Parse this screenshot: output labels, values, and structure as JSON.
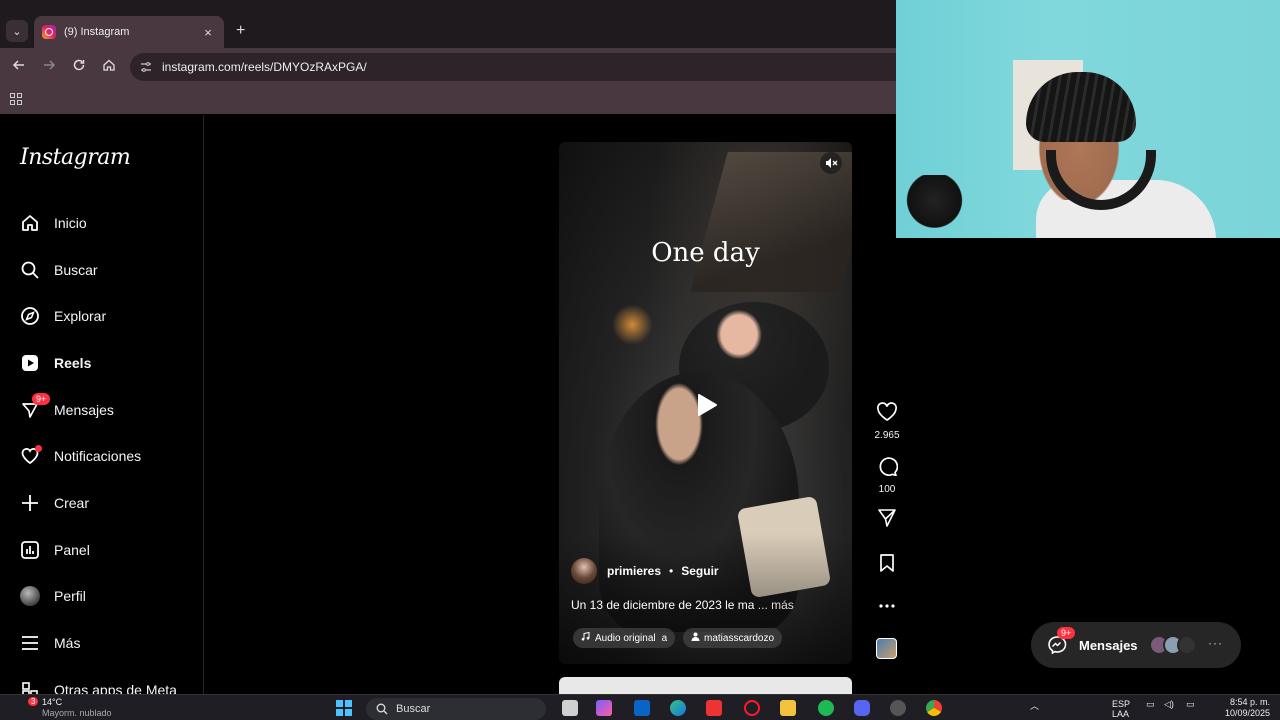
{
  "browser": {
    "tab_title": "(9) Instagram",
    "tab_close": "×",
    "new_tab": "+",
    "tab_list": "⌄",
    "url": "instagram.com/reels/DMYOzRAxPGA/"
  },
  "sidebar": {
    "logo": "Instagram",
    "items": [
      {
        "label": "Inicio",
        "icon": "home-icon"
      },
      {
        "label": "Buscar",
        "icon": "search-icon"
      },
      {
        "label": "Explorar",
        "icon": "compass-icon"
      },
      {
        "label": "Reels",
        "icon": "reels-icon"
      },
      {
        "label": "Mensajes",
        "icon": "messenger-icon",
        "badge": "9+"
      },
      {
        "label": "Notificaciones",
        "icon": "heart-icon"
      },
      {
        "label": "Crear",
        "icon": "plus-icon"
      },
      {
        "label": "Panel",
        "icon": "dashboard-icon"
      },
      {
        "label": "Perfil",
        "icon": "avatar"
      },
      {
        "label": "Más",
        "icon": "menu-icon"
      },
      {
        "label": "Otras apps de Meta",
        "icon": "meta-apps-icon"
      }
    ]
  },
  "reel": {
    "overlay_text": "One day",
    "author": "primieres",
    "separator": "•",
    "follow": "Seguir",
    "description": "Un 13 de diciembre de 2023 le ma",
    "more": "... más",
    "audio_pill": "Audio original",
    "audio_suffix": "a",
    "tagged_user": "matiasscardozo"
  },
  "actions": {
    "likes": "2.965",
    "comments": "100"
  },
  "messages_pill": {
    "label": "Mensajes",
    "badge": "9+",
    "more": "···"
  },
  "taskbar": {
    "temperature": "14°C",
    "weather_desc": "Mayorm. nublado",
    "weather_badge": "3",
    "search": "Buscar",
    "lang": "ESP",
    "lang_sub": "LAA",
    "time": "8:54 p. m.",
    "date": "10/09/2025"
  },
  "colors": {
    "accent_red": "#ff3040",
    "browser_frame": "#4a3840",
    "ig_background": "#000000"
  }
}
